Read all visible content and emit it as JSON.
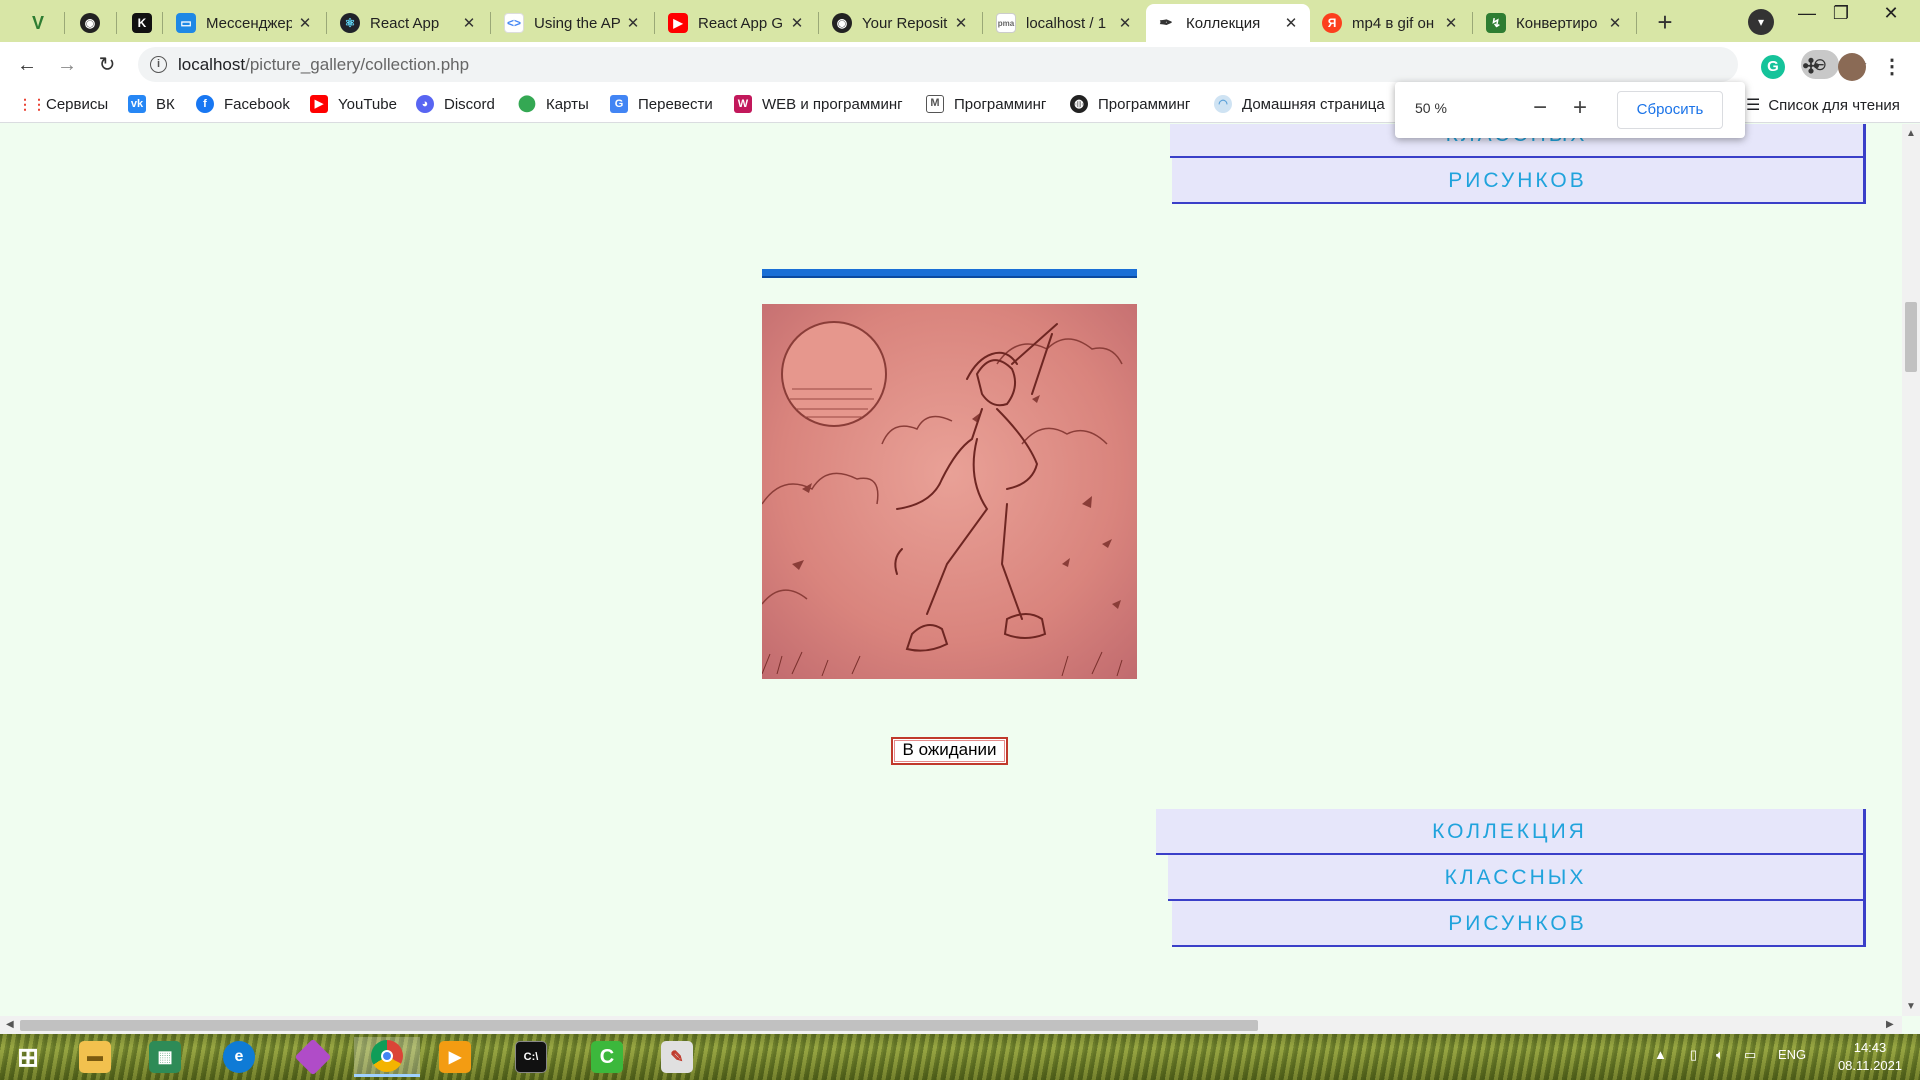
{
  "tabs": [
    {
      "title": "",
      "icon": "vuejs-icon"
    },
    {
      "title": "",
      "icon": "github-icon"
    },
    {
      "title": "",
      "icon": "k-icon"
    },
    {
      "title": "Мессенджер",
      "icon": "messenger-icon"
    },
    {
      "title": "React App",
      "icon": "react-icon"
    },
    {
      "title": "Using the AP",
      "icon": "code-icon"
    },
    {
      "title": "React App G",
      "icon": "youtube-icon"
    },
    {
      "title": "Your Reposit",
      "icon": "github-icon"
    },
    {
      "title": "localhost / 1",
      "icon": "phpmyadmin-icon"
    },
    {
      "title": "Коллекция",
      "icon": "feather-icon"
    },
    {
      "title": "mp4 в gif он",
      "icon": "yandex-icon"
    },
    {
      "title": "Конвертиро",
      "icon": "converter-icon"
    }
  ],
  "address_bar": {
    "host": "localhost",
    "path": "/picture_gallery/collection.php"
  },
  "zoom_chip_icon": "zoom-out-icon",
  "bookmarks": [
    {
      "label": "Сервисы",
      "icon": "apps-grid-icon",
      "color": "#ea4335"
    },
    {
      "label": "ВК",
      "icon": "vk-icon",
      "color": "#2787f5"
    },
    {
      "label": "Facebook",
      "icon": "facebook-icon",
      "color": "#1877f2"
    },
    {
      "label": "YouTube",
      "icon": "youtube-icon",
      "color": "#ff0000"
    },
    {
      "label": "Discord",
      "icon": "discord-icon",
      "color": "#5865f2"
    },
    {
      "label": "Карты",
      "icon": "maps-icon",
      "color": "#34a853"
    },
    {
      "label": "Перевести",
      "icon": "translate-icon",
      "color": "#4285f4"
    },
    {
      "label": "WEB и программинг",
      "icon": "folder-icon",
      "color": "#c2185b"
    },
    {
      "label": "Программинг",
      "icon": "gmail-icon",
      "color": "#555555"
    },
    {
      "label": "Программинг",
      "icon": "globe-icon",
      "color": "#222222"
    },
    {
      "label": "Домашняя страница",
      "icon": "home-page-icon",
      "color": "#5aa0d8"
    }
  ],
  "reading_list": "Список для чтения",
  "zoom_popup": {
    "level": "50 %",
    "minus": "−",
    "plus": "+",
    "reset": "Сбросить"
  },
  "page": {
    "top_menu": [
      "КЛАССНЫХ",
      "РИСУНКОВ"
    ],
    "bottom_menu": [
      "КОЛЛЕКЦИЯ",
      "КЛАССНЫХ",
      "РИСУНКОВ"
    ],
    "status_button": "В ожидании",
    "artwork_icon": "anime-boy-sketch-image"
  },
  "taskbar": {
    "apps": [
      "windows-start-icon",
      "file-explorer-icon",
      "spreadsheet-icon",
      "edge-icon",
      "gem-app-icon",
      "chrome-icon",
      "media-player-icon",
      "terminal-icon",
      "camtasia-icon",
      "paint-icon"
    ],
    "language": "ENG",
    "time": "14:43",
    "date": "08.11.2021"
  },
  "colors": {
    "page_bg": "#f0fdf0",
    "menu_bg": "#e6e6fa",
    "menu_text": "#20a3dc",
    "menu_border": "#3a3fc8",
    "bar": "#1a6fd6",
    "status_border": "#c0392b"
  }
}
